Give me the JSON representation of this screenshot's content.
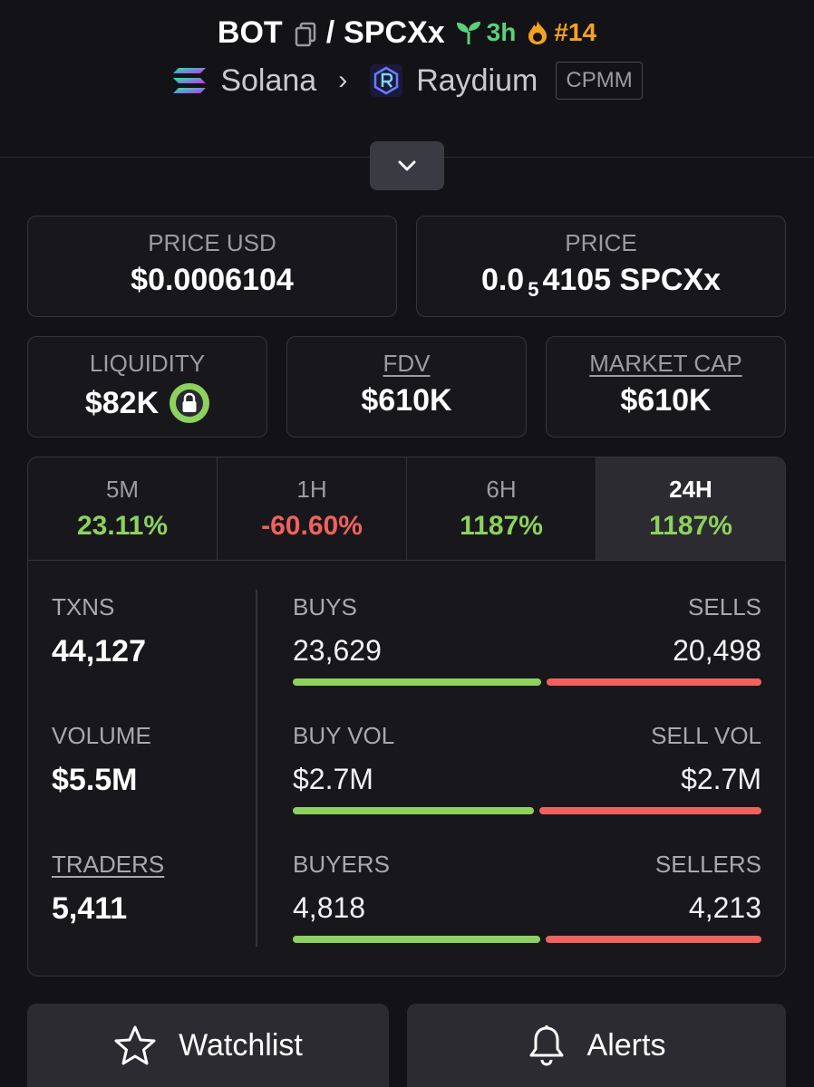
{
  "header": {
    "base_token": "BOT",
    "separator": "/",
    "quote_token": "SPCXx",
    "age": "3h",
    "rank": "#14",
    "chain": "Solana",
    "dex": "Raydium",
    "pool_type": "CPMM"
  },
  "price": {
    "usd_label": "PRICE USD",
    "usd_value": "$0.0006104",
    "native_label": "PRICE",
    "native_prefix": "0.0",
    "native_zeros": "5",
    "native_suffix": "4105 SPCXx"
  },
  "metrics": {
    "liquidity_label": "LIQUIDITY",
    "liquidity_value": "$82K",
    "fdv_label": "FDV",
    "fdv_value": "$610K",
    "mcap_label": "MARKET CAP",
    "mcap_value": "$610K"
  },
  "tabs": [
    {
      "label": "5M",
      "change": "23.11%"
    },
    {
      "label": "1H",
      "change": "-60.60%"
    },
    {
      "label": "6H",
      "change": "1187%"
    },
    {
      "label": "24H",
      "change": "1187%"
    }
  ],
  "stats": {
    "txns_label": "TXNS",
    "txns_value": "44,127",
    "volume_label": "VOLUME",
    "volume_value": "$5.5M",
    "traders_label": "TRADERS",
    "traders_value": "5,411",
    "buys_label": "BUYS",
    "buys_value": "23,629",
    "sells_label": "SELLS",
    "sells_value": "20,498",
    "buy_vol_label": "BUY VOL",
    "buy_vol_value": "$2.7M",
    "sell_vol_label": "SELL VOL",
    "sell_vol_value": "$2.7M",
    "buyers_label": "BUYERS",
    "buyers_value": "4,818",
    "sellers_label": "SELLERS",
    "sellers_value": "4,213",
    "buy_vol_share": 0.52
  },
  "actions": {
    "watchlist_label": "Watchlist",
    "alerts_label": "Alerts"
  },
  "colors": {
    "positive": "#8dd15e",
    "negative": "#f0625d",
    "age": "#5ad17a",
    "rank": "#f6a21e"
  }
}
